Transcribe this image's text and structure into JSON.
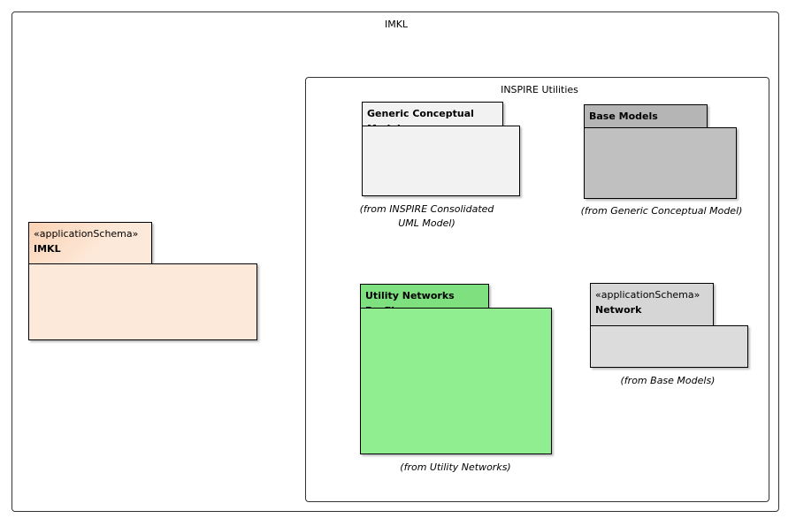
{
  "outer": {
    "title": "IMKL"
  },
  "inspire": {
    "title": "INSPIRE Utilities"
  },
  "packages": {
    "gcm": {
      "name": "Generic Conceptual Model",
      "caption": "(from INSPIRE Consolidated UML Model)",
      "fill": "#f2f2f2"
    },
    "base": {
      "name": "Base Models",
      "caption": "(from Generic Conceptual Model)",
      "fill": "#c0c0c0"
    },
    "imkl": {
      "stereotype": "«applicationSchema»",
      "name": "IMKL",
      "fill": "#fde9d9"
    },
    "unp": {
      "name": "Utility Networks Profile",
      "caption": "(from Utility Networks)",
      "fill": "#90ee90"
    },
    "network": {
      "stereotype": "«applicationSchema»",
      "name": "Network",
      "caption": "(from Base Models)",
      "fill": "#dcdcdc"
    }
  }
}
